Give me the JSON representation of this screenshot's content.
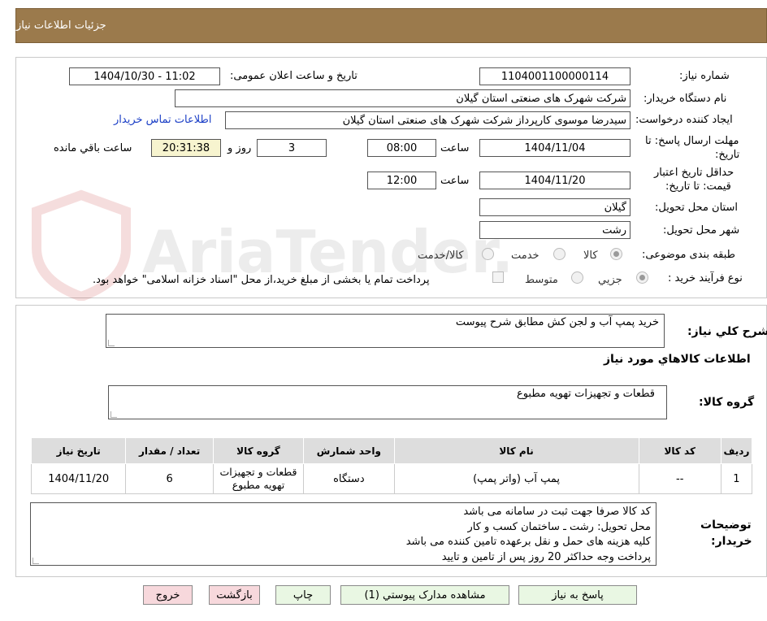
{
  "header": {
    "title": "جزئیات اطلاعات نیاز"
  },
  "form": {
    "need_number_label": "شماره نیاز:",
    "need_number": "1104001100000114",
    "announce_label": "تاریخ و ساعت اعلان عمومی:",
    "announce_value": "1404/10/30 - 11:02",
    "buyer_org_label": "نام دستگاه خریدار:",
    "buyer_org": "شرکت شهرک های صنعتی استان گیلان",
    "requester_label": "ایجاد کننده درخواست:",
    "requester": "سیدرضا موسوی کارپرداز  شرکت شهرک های صنعتی استان گیلان",
    "contact_link": "اطلاعات تماس خریدار",
    "deadline_label_1": "مهلت ارسال پاسخ: تا",
    "deadline_label_2": "تاریخ:",
    "deadline_date": "1404/11/04",
    "time_label": "ساعت",
    "deadline_time": "08:00",
    "days_value": "3",
    "days_label": "روز و",
    "remaining_time": "20:31:38",
    "remaining_label": "ساعت باقي مانده",
    "validity_label_1": "حداقل تاریخ اعتبار",
    "validity_label_2": "قیمت: تا تاریخ:",
    "validity_date": "1404/11/20",
    "validity_time_label": "ساعت",
    "validity_time": "12:00",
    "province_label": "استان محل تحویل:",
    "province": "گیلان",
    "city_label": "شهر محل تحویل:",
    "city": "رشت",
    "category_label": "طبقه بندی موضوعی:",
    "category_options": [
      "کالا",
      "خدمت",
      "کالا/خدمت"
    ],
    "process_label": "نوع فرآیند خرید :",
    "process_options": [
      "جزیي",
      "متوسط"
    ],
    "payment_note": "پرداخت تمام یا بخشی از مبلغ خرید،از محل \"اسناد خزانه اسلامی\" خواهد بود."
  },
  "summary": {
    "label": "شرح کلي نیاز:",
    "value": "خرید پمپ آب و لجن کش مطابق شرح پیوست",
    "goods_info_title": "اطلاعات کالاهاي مورد نیاز",
    "goods_group_label": "گروه کالا:",
    "goods_group_value": "قطعات و تجهیزات تهویه مطبوع"
  },
  "table": {
    "headers": [
      "ردیف",
      "کد کالا",
      "نام کالا",
      "واحد شمارش",
      "گروه کالا",
      "تعداد / مقدار",
      "تاریخ نیاز"
    ],
    "rows": [
      [
        "1",
        "--",
        "پمپ آب (واتر پمپ)",
        "دستگاه",
        "قطعات و تجهیزات تهویه مطبوع",
        "6",
        "1404/11/20"
      ]
    ]
  },
  "notes": {
    "label_1": "توضیحات",
    "label_2": "خریدار:",
    "lines": [
      "کد کالا صرفا جهت ثبت در سامانه می باشد",
      "محل تحویل: رشت ـ ساختمان کسب و کار",
      "کلیه هزینه های حمل و نقل برعهده تامین کننده می باشد",
      "پرداخت وجه حداکثر 20 روز پس از تامین و تایید"
    ]
  },
  "buttons": {
    "reply": "پاسخ به نیاز",
    "attachments": "مشاهده مدارک پیوستي (1)",
    "print": "چاپ",
    "back": "بازگشت",
    "exit": "خروج"
  },
  "watermark": {
    "text": "AriaTender.net"
  },
  "colors": {
    "header_bg": "#9b7a4c",
    "link": "#1a3ec6",
    "remaining_bg": "#f7f4cf"
  }
}
